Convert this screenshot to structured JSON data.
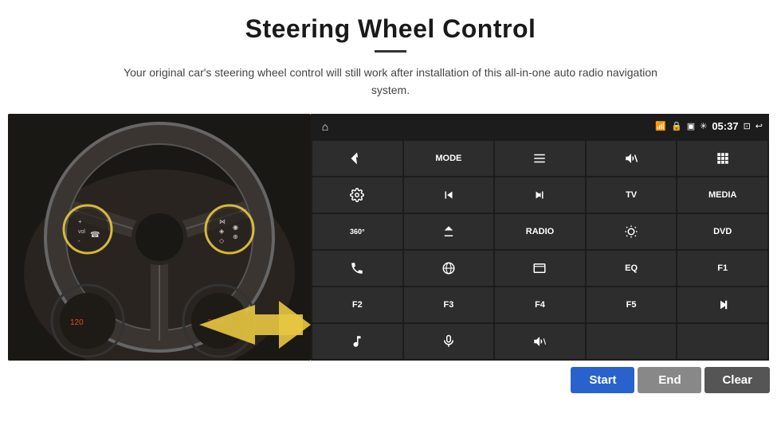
{
  "page": {
    "title": "Steering Wheel Control",
    "subtitle": "Your original car's steering wheel control will still work after installation of this all-in-one auto radio navigation system.",
    "underline": true
  },
  "status_bar": {
    "time": "05:37"
  },
  "buttons": {
    "start_label": "Start",
    "end_label": "End",
    "clear_label": "Clear"
  },
  "grid_rows": [
    [
      {
        "icon": "nav",
        "text": ""
      },
      {
        "icon": "",
        "text": "MODE"
      },
      {
        "icon": "list",
        "text": ""
      },
      {
        "icon": "mute",
        "text": ""
      },
      {
        "icon": "apps",
        "text": ""
      }
    ],
    [
      {
        "icon": "settings",
        "text": ""
      },
      {
        "icon": "prev",
        "text": ""
      },
      {
        "icon": "next",
        "text": ""
      },
      {
        "icon": "",
        "text": "TV"
      },
      {
        "icon": "",
        "text": "MEDIA"
      }
    ],
    [
      {
        "icon": "360",
        "text": ""
      },
      {
        "icon": "eject",
        "text": ""
      },
      {
        "icon": "",
        "text": "RADIO"
      },
      {
        "icon": "brightness",
        "text": ""
      },
      {
        "icon": "",
        "text": "DVD"
      }
    ],
    [
      {
        "icon": "phone",
        "text": ""
      },
      {
        "icon": "wifi-globe",
        "text": ""
      },
      {
        "icon": "window",
        "text": ""
      },
      {
        "icon": "",
        "text": "EQ"
      },
      {
        "icon": "",
        "text": "F1"
      }
    ],
    [
      {
        "icon": "",
        "text": "F2"
      },
      {
        "icon": "",
        "text": "F3"
      },
      {
        "icon": "",
        "text": "F4"
      },
      {
        "icon": "",
        "text": "F5"
      },
      {
        "icon": "play-pause",
        "text": ""
      }
    ],
    [
      {
        "icon": "music",
        "text": ""
      },
      {
        "icon": "mic",
        "text": ""
      },
      {
        "icon": "vol-call",
        "text": ""
      },
      {
        "icon": "",
        "text": ""
      },
      {
        "icon": "",
        "text": ""
      }
    ]
  ]
}
